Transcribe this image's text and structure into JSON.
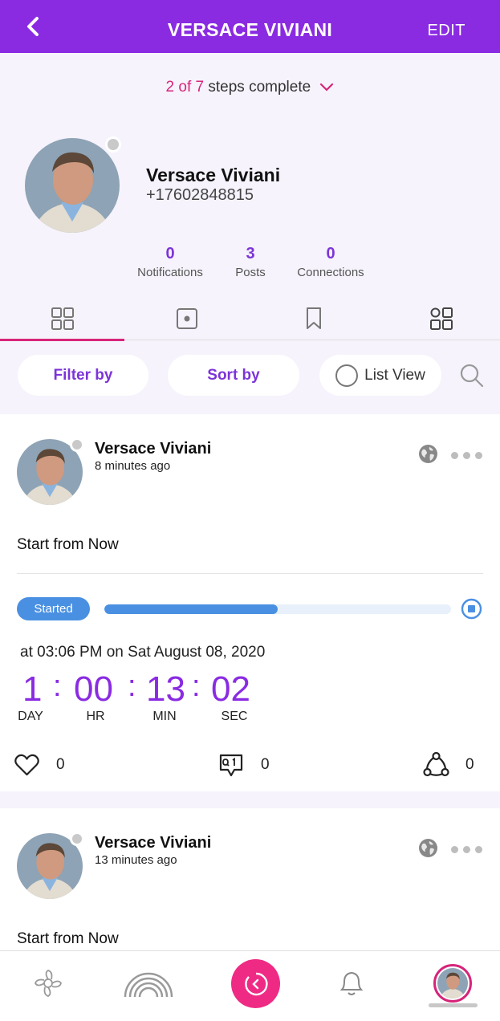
{
  "header": {
    "title": "VERSACE VIVIANI",
    "edit_label": "EDIT"
  },
  "steps": {
    "done": "2",
    "of": " of ",
    "total": "7",
    "suffix": " steps complete"
  },
  "profile": {
    "name": "Versace Viviani",
    "phone": "+17602848815"
  },
  "stats": [
    {
      "value": "0",
      "label": "Notifications"
    },
    {
      "value": "3",
      "label": "Posts"
    },
    {
      "value": "0",
      "label": "Connections"
    }
  ],
  "tabs": {
    "active": "grid-view",
    "items": [
      "grid-view",
      "stories",
      "saved",
      "apps"
    ]
  },
  "controls": {
    "filter_label": "Filter by",
    "sort_label": "Sort by",
    "list_view_label": "List View"
  },
  "posts": [
    {
      "author": "Versace Viviani",
      "time": "8 minutes ago",
      "text": "Start from Now",
      "status": "Started",
      "progress_percent": 50,
      "scheduled": "at 03:06 PM on Sat August 08, 2020",
      "timer": {
        "day": "1",
        "hr": "00",
        "min": "13",
        "sec": "02",
        "day_label": "DAY",
        "hr_label": "HR",
        "min_label": "MIN",
        "sec_label": "SEC",
        "sep": ":"
      },
      "likes": "0",
      "comments": "0",
      "shares": "0"
    },
    {
      "author": "Versace Viviani",
      "time": "13 minutes ago",
      "text": "Start from Now"
    }
  ],
  "colors": {
    "brand_purple": "#8a2be2",
    "accent_pink": "#d6257a",
    "progress_blue": "#4a90e2",
    "background": "#f6f3fc"
  },
  "bottom_nav": [
    "flower-icon",
    "rainbow-icon",
    "timer-icon",
    "bell-icon",
    "profile-avatar"
  ]
}
